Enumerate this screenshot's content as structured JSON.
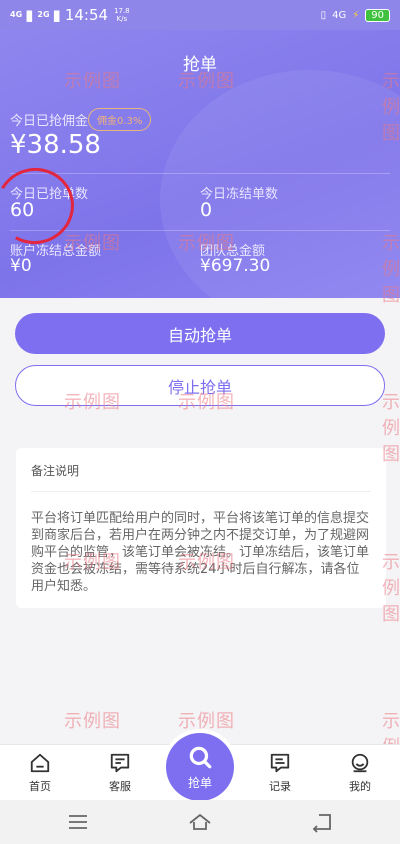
{
  "status": {
    "signal1": "4G",
    "signal2": "2G",
    "time": "14:54",
    "speed_value": "17.8",
    "speed_unit": "K/s",
    "network": "4G",
    "battery": "90"
  },
  "header": {
    "title": "抢单"
  },
  "stats": {
    "commission_label": "今日已抢佣金",
    "commission_rate": "佣金0.3%",
    "commission_value": "¥38.58",
    "orders_label": "今日已抢单数",
    "orders_value": "60",
    "frozen_label": "今日冻结单数",
    "frozen_value": "0",
    "account_frozen_label": "账户冻结总金额",
    "account_frozen_value": "¥0",
    "team_total_label": "团队总金额",
    "team_total_value": "¥697.30"
  },
  "actions": {
    "auto_grab": "自动抢单",
    "stop_grab": "停止抢单"
  },
  "note": {
    "title": "备注说明",
    "body": "平台将订单匹配给用户的同时，平台将该笔订单的信息提交到商家后台，若用户在两分钟之内不提交订单，为了规避网购平台的监管，该笔订单会被冻结。订单冻结后，该笔订单资金也会被冻结，需等待系统24小时后自行解冻，请各位用户知悉。"
  },
  "watermark": {
    "text": "示例图"
  },
  "tabbar": {
    "home": "首页",
    "service": "客服",
    "grab": "抢单",
    "records": "记录",
    "mine": "我的"
  },
  "colors": {
    "accent": "#7d6ff0",
    "annotation": "#e3253d"
  },
  "icons": {
    "home": "home-icon",
    "service": "chat-icon",
    "grab": "search-icon",
    "records": "message-icon",
    "mine": "user-icon",
    "nav_menu": "menu-icon",
    "nav_home": "home-outline-icon",
    "nav_back": "back-icon"
  }
}
